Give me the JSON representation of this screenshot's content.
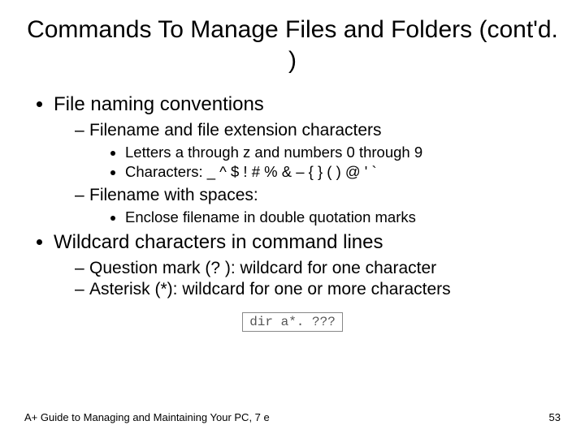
{
  "title": "Commands To Manage Files and Folders (cont'd. )",
  "bullets": {
    "b1": "File naming conventions",
    "b1_1": "Filename and file extension characters",
    "b1_1_1": "Letters a through z and numbers 0 through 9",
    "b1_1_2": "Characters: _ ^ $ ! # % & – { } ( ) @ ' `",
    "b1_2": "Filename with spaces:",
    "b1_2_1": "Enclose filename in double quotation marks",
    "b2": "Wildcard characters in command lines",
    "b2_1": "Question mark (? ): wildcard for one character",
    "b2_2": "Asterisk (*): wildcard for one or more characters"
  },
  "code": "dir a*. ???",
  "footer_left": "A+ Guide to Managing and Maintaining Your PC, 7 e",
  "footer_right": "53"
}
